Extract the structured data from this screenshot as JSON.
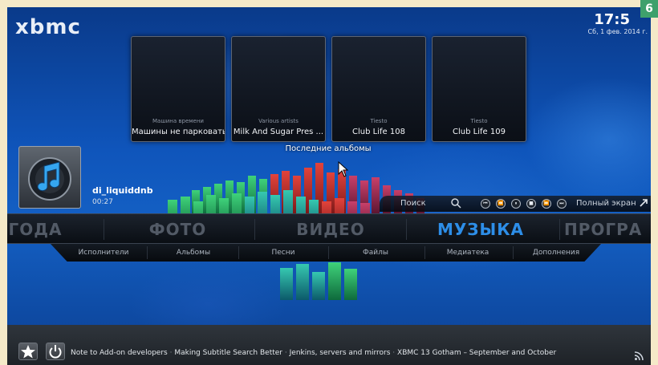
{
  "app": {
    "logo": "xbmc"
  },
  "clock": {
    "time": "17:5",
    "date": "Сб, 1 фев. 2014 г."
  },
  "badge": "6",
  "albums": [
    {
      "artist": "Машина времени",
      "title": "Машины не парковать"
    },
    {
      "artist": "Various artists",
      "title": "Milk And Sugar Pres ..."
    },
    {
      "artist": "Tiesto",
      "title": "Club Life 108"
    },
    {
      "artist": "Tiesto",
      "title": "Club Life 109"
    }
  ],
  "albums_caption": "Последние альбомы",
  "now_playing": {
    "title": "di_liquiddnb",
    "time": "00:27",
    "icon": "music-note-icon"
  },
  "controls": {
    "search_label": "Поиск",
    "fullscreen_label": "Полный экран",
    "buttons": [
      "prev-icon",
      "rewind-icon",
      "pause-icon",
      "stop-icon",
      "fast-forward-icon",
      "next-icon"
    ]
  },
  "main_menu": {
    "items": [
      "ГОДА",
      "ФОТО",
      "ВИДЕО",
      "МУЗЫКА",
      "ПРОГРА"
    ],
    "active": "МУЗЫКА"
  },
  "sub_menu": {
    "items": [
      "Исполнители",
      "Альбомы",
      "Песни",
      "Файлы",
      "Медиатека",
      "Дополнения"
    ]
  },
  "news": {
    "items": [
      "Note to Add-on developers",
      "Making Subtitle Search Better",
      "Jenkins, servers and mirrors",
      "XBMC 13 Gotham – September and October"
    ],
    "separator": "·"
  },
  "colors": {
    "accent": "#2d8ee8",
    "background": "#0f55bb",
    "badge": "#3ea06c"
  }
}
